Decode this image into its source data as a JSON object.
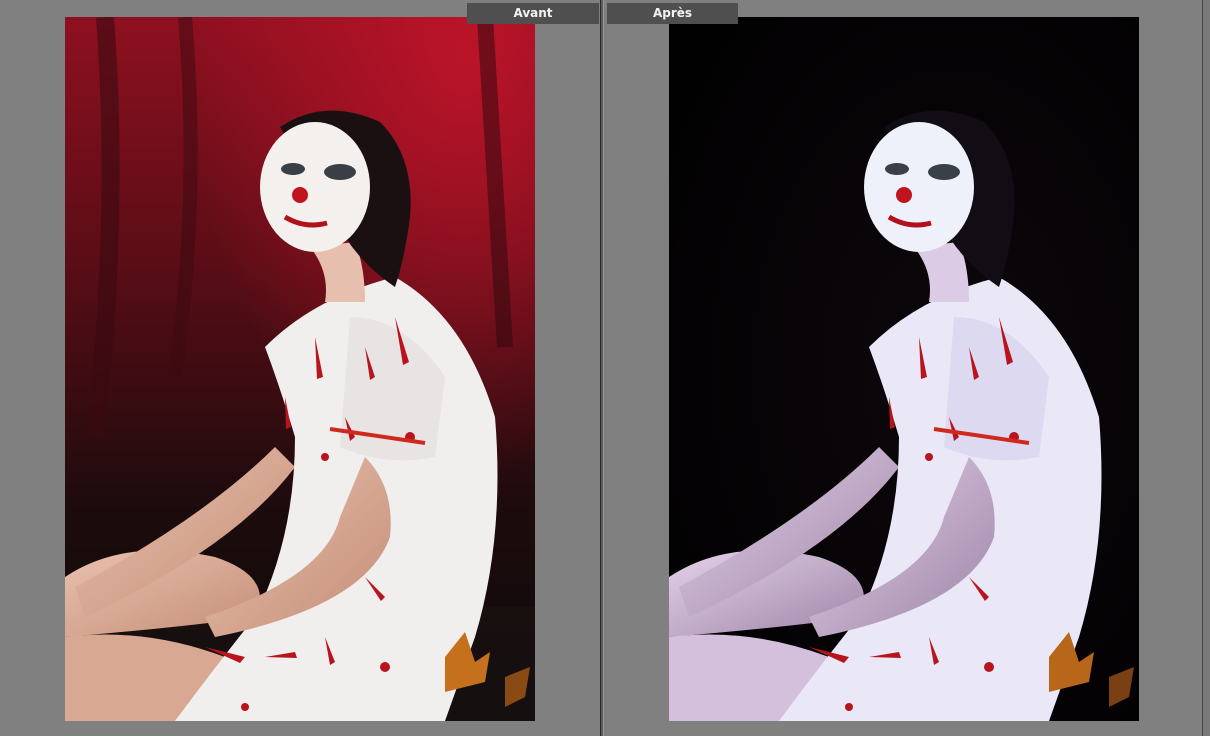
{
  "panes": {
    "before": {
      "label": "Avant"
    },
    "after": {
      "label": "Après"
    }
  },
  "colors": {
    "background": "#808080",
    "label_background": "#4f4f4f",
    "label_text": "#f2f2f2",
    "before_backdrop": "#7a0f1a",
    "after_backdrop": "#050305"
  }
}
